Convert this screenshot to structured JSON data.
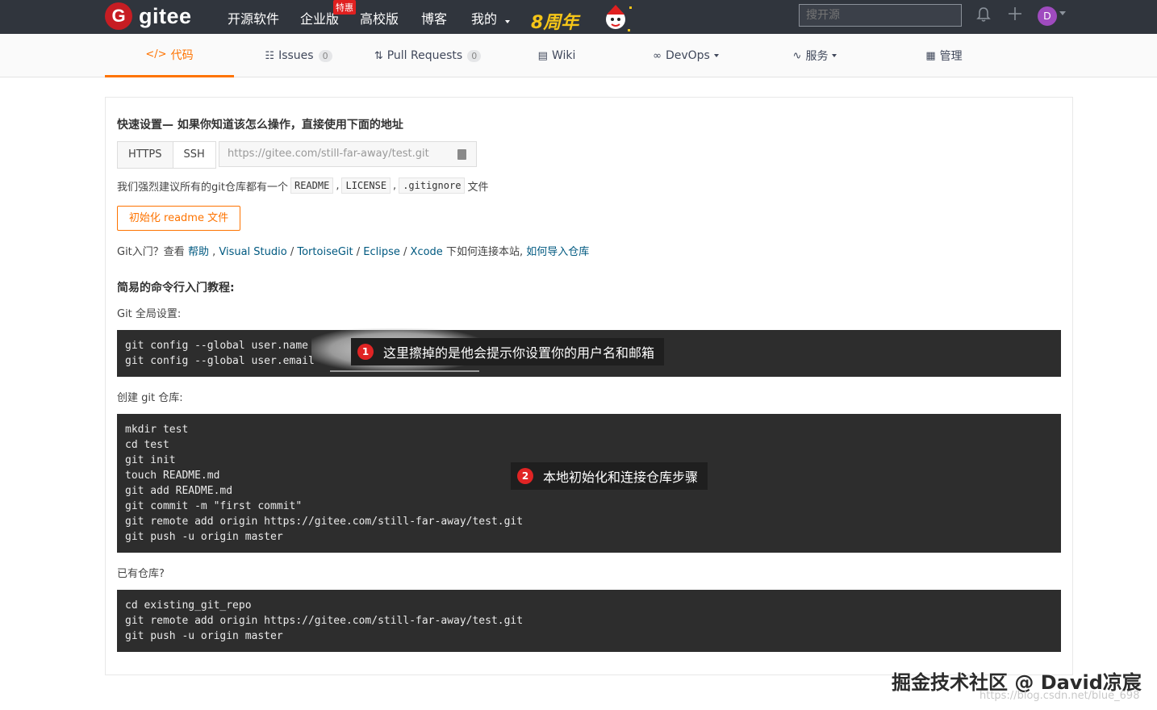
{
  "topbar": {
    "logo_letter": "G",
    "logo_text": "gitee",
    "nav": [
      "开源软件",
      "企业版",
      "高校版",
      "博客",
      "我的"
    ],
    "enterprise_badge": "特惠",
    "anniversary": "8周年",
    "search_placeholder": "搜开源",
    "avatar_letter": "D",
    "icons": [
      "bell-icon",
      "plus-icon"
    ]
  },
  "tabs": [
    {
      "label": "代码",
      "icon": "code-icon",
      "active": true
    },
    {
      "label": "Issues",
      "icon": "issues-icon",
      "count": "0"
    },
    {
      "label": "Pull Requests",
      "icon": "pull-request-icon",
      "count": "0"
    },
    {
      "label": "Wiki",
      "icon": "wiki-icon"
    },
    {
      "label": "DevOps",
      "icon": "devops-icon",
      "dropdown": true
    },
    {
      "label": "服务",
      "icon": "service-icon",
      "dropdown": true
    },
    {
      "label": "管理",
      "icon": "manage-icon"
    }
  ],
  "quick_setup": {
    "title": "快速设置— 如果你知道该怎么操作，直接使用下面的地址",
    "protocols": [
      "HTTPS",
      "SSH"
    ],
    "url": "https://gitee.com/still-far-away/test.git",
    "advise_prefix": "我们强烈建议所有的git仓库都有一个",
    "advise_files": [
      "README",
      "LICENSE",
      ".gitignore"
    ],
    "advise_suffix": "文件",
    "init_button": "初始化 readme 文件",
    "help_prefix": "Git入门？查看",
    "help_links": [
      "帮助",
      "Visual Studio",
      "TortoiseGit",
      "Eclipse",
      "Xcode"
    ],
    "help_mid": "下如何连接本站,",
    "help_last_link": "如何导入仓库"
  },
  "tutorial": {
    "title": "简易的命令行入门教程:",
    "global_label": "Git 全局设置:",
    "global_code": [
      "git config --global user.name",
      "git config --global user.email"
    ],
    "create_label": "创建 git 仓库:",
    "create_code": [
      "mkdir test",
      "cd test",
      "git init",
      "touch README.md",
      "git add README.md",
      "git commit -m \"first commit\"",
      "git remote add origin https://gitee.com/still-far-away/test.git",
      "git push -u origin master"
    ],
    "existing_label": "已有仓库?",
    "existing_code": [
      "cd existing_git_repo",
      "git remote add origin https://gitee.com/still-far-away/test.git",
      "git push -u origin master"
    ]
  },
  "annotations": [
    {
      "num": "1",
      "text": "这里擦掉的是他会提示你设置你的用户名和邮箱"
    },
    {
      "num": "2",
      "text": "本地初始化和连接仓库步骤"
    }
  ],
  "watermark": {
    "main": "掘金技术社区 @ David凉宸",
    "sub": "https://blog.csdn.net/blue_698"
  },
  "colors": {
    "accent": "#fe7300",
    "topbar": "#30353d",
    "code_bg": "#2d2d2d",
    "link": "#005980"
  }
}
